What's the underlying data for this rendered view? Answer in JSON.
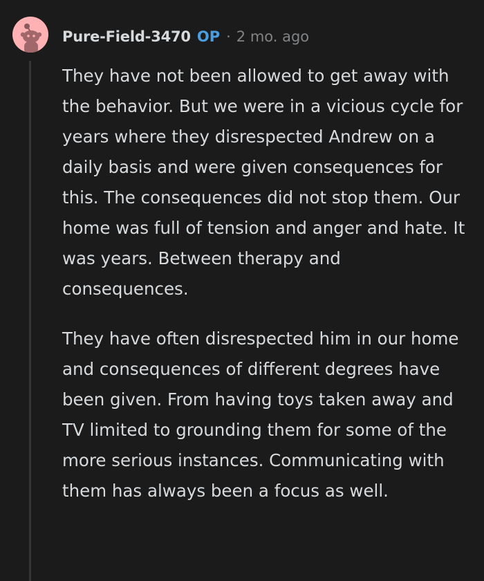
{
  "comment": {
    "username": "Pure-Field-3470",
    "badge": "OP",
    "separator": "·",
    "timestamp": "2 mo. ago",
    "avatar_icon": "reddit-snoo-icon",
    "avatar_color": "#ffb1b3",
    "paragraphs": [
      "They have not been allowed to get away with the behavior. But we were in a vicious cycle for years where they disrespected Andrew on a daily basis and were given consequences for this. The consequences did not stop them. Our home was full of tension and anger and hate. It was years. Between therapy and consequences.",
      "They have often disrespected him in our home and consequences of different degrees have been given. From having toys taken away and TV limited to grounding them for some of the more serious instances. Communicating with them has always been a focus as well."
    ]
  }
}
